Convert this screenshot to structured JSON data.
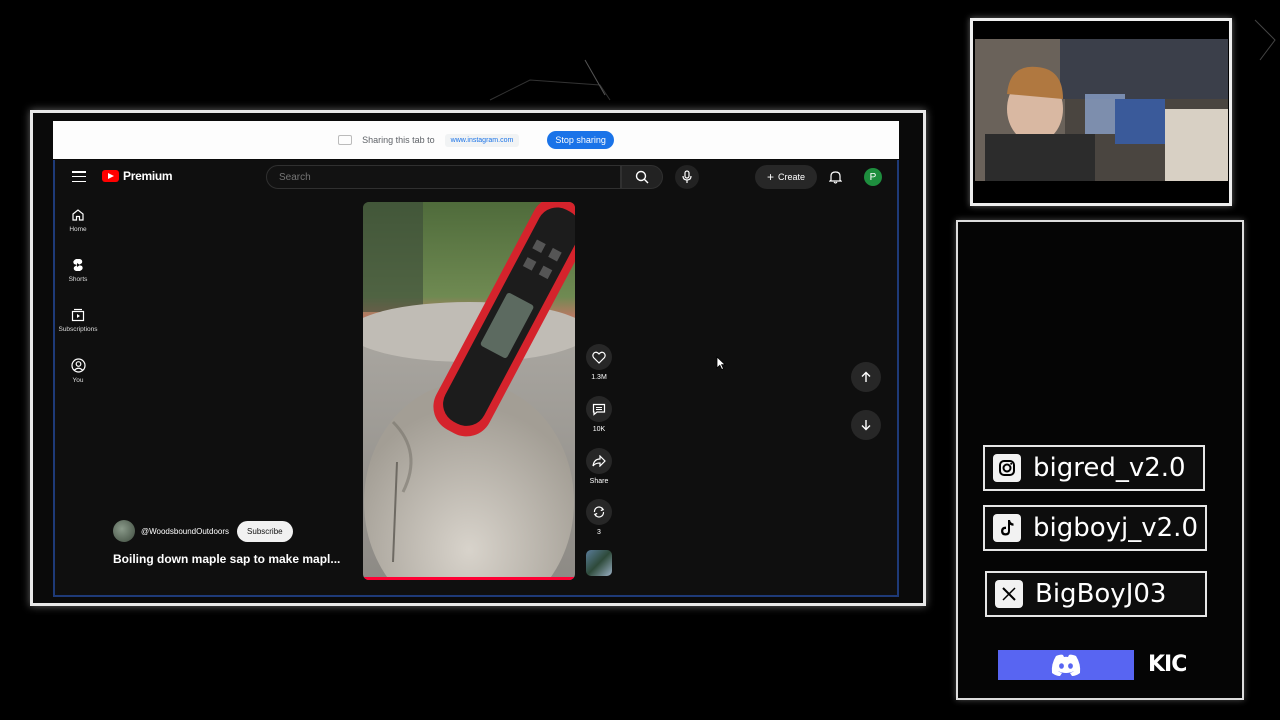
{
  "share_bar": {
    "text": "Sharing this tab to",
    "domain": "www.instagram.com",
    "stop_label": "Stop sharing"
  },
  "youtube": {
    "brand": "Premium",
    "search_placeholder": "Search",
    "create_label": "Create",
    "avatar_letter": "P",
    "sidebar": [
      {
        "label": "Home",
        "icon": "home-icon"
      },
      {
        "label": "Shorts",
        "icon": "shorts-icon"
      },
      {
        "label": "Subscriptions",
        "icon": "subscriptions-icon"
      },
      {
        "label": "You",
        "icon": "you-icon"
      }
    ],
    "actions": {
      "likes": "1.3M",
      "comments": "10K",
      "share": "Share",
      "remix": "3"
    },
    "channel": {
      "handle": "@WoodsboundOutdoors",
      "subscribe_label": "Subscribe"
    },
    "video_title": "Boiling down maple sap to make mapl..."
  },
  "socials": {
    "instagram": "bigred_v2.0",
    "tiktok": "bigboyj_v2.0",
    "x": "BigBoyJ03",
    "kick": "KIC"
  },
  "colors": {
    "accent": "#1a73e8",
    "youtube_red": "#ff0000",
    "discord": "#5865f2",
    "avatar_green": "#1e8e3e"
  }
}
